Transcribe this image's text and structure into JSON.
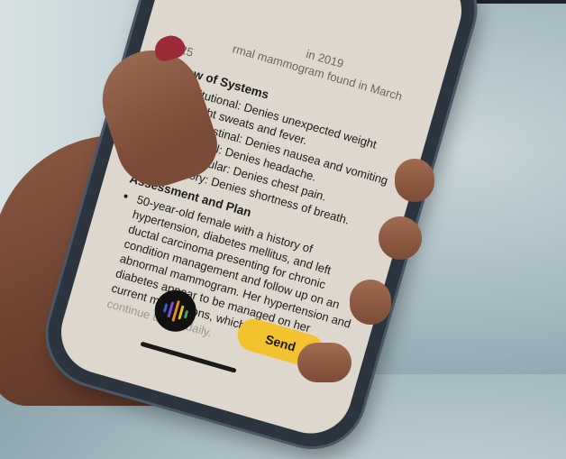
{
  "note": {
    "top_lines": [
      "in 2019",
      "rmal mammogram found in March",
      "2025"
    ],
    "sections": [
      {
        "heading": "Review of Systems",
        "items": [
          "Constitutional: Denies unexpected weight loss, night sweats and fever.",
          "Gastrointestinal: Denies nausea and vomiting",
          "Neurological: Denies headache.",
          "Cardiovascular: Denies chest pain.",
          "Respiratory: Denies shortness of breath."
        ]
      },
      {
        "heading": "Assessment and Plan",
        "items": [
          "50-year-old female with a history of hypertension, diabetes mellitus, and left ductal carcinoma presenting for chronic condition management and follow up on an abnormal mammogram. Her hypertension and diabetes appear to be managed on her current medications, which she is to"
        ]
      }
    ],
    "trailing_text": "continue taking daily."
  },
  "controls": {
    "send_label": "Send",
    "mic_icon": "waveform-icon"
  },
  "colors": {
    "send_button": "#f2c32e",
    "screen_bg": "#ddd7cd",
    "nail_polish": "#9c2b3a",
    "waveform": [
      "#3a5bd9",
      "#7c4fd1",
      "#e08a2a",
      "#e0c22a",
      "#4aa36a"
    ]
  }
}
